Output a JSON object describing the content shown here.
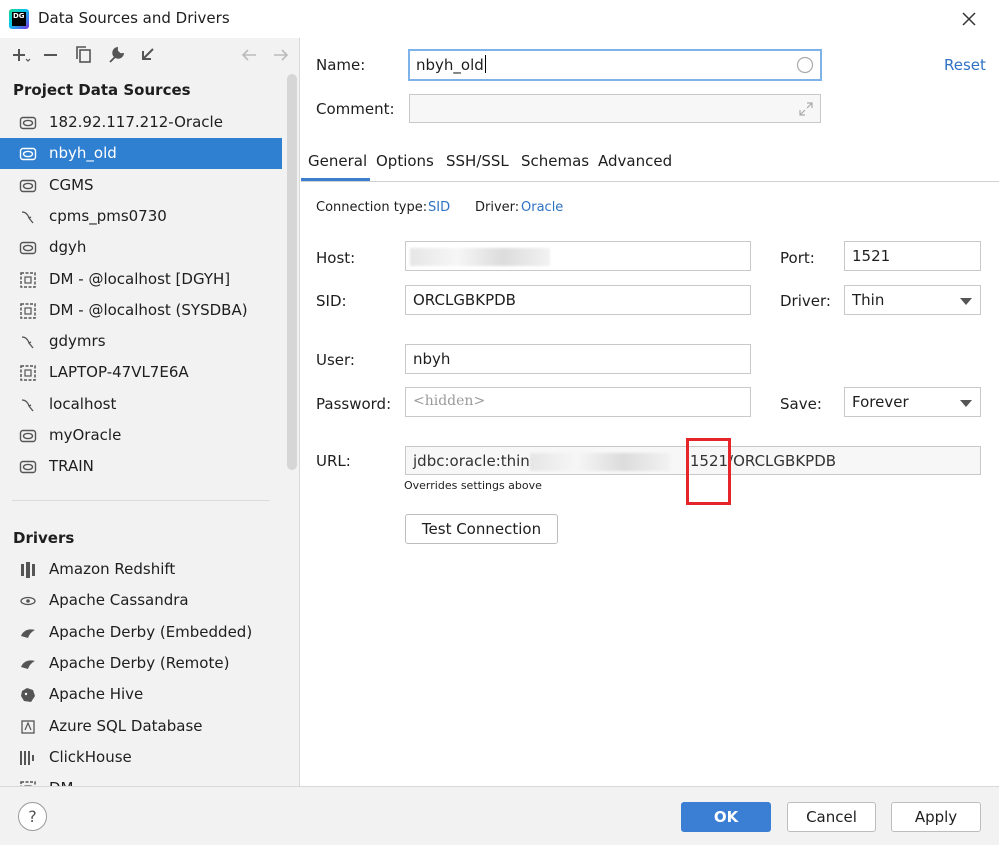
{
  "window": {
    "title": "Data Sources and Drivers"
  },
  "left": {
    "project_header": "Project Data Sources",
    "data_sources": [
      {
        "label": "182.92.117.212-Oracle",
        "icon": "oracle-icon",
        "selected": false
      },
      {
        "label": "nbyh_old",
        "icon": "oracle-icon",
        "selected": true
      },
      {
        "label": "CGMS",
        "icon": "oracle-icon",
        "selected": false
      },
      {
        "label": "cpms_pms0730",
        "icon": "mysql-icon",
        "selected": false
      },
      {
        "label": "dgyh",
        "icon": "oracle-icon",
        "selected": false
      },
      {
        "label": "DM - @localhost [DGYH]",
        "icon": "dm-icon",
        "selected": false
      },
      {
        "label": "DM - @localhost  (SYSDBA)",
        "icon": "dm-icon",
        "selected": false
      },
      {
        "label": "gdymrs",
        "icon": "mysql-icon",
        "selected": false
      },
      {
        "label": "LAPTOP-47VL7E6A",
        "icon": "dm-icon",
        "selected": false
      },
      {
        "label": "localhost",
        "icon": "mysql-icon",
        "selected": false
      },
      {
        "label": "myOracle",
        "icon": "oracle-icon",
        "selected": false
      },
      {
        "label": "TRAIN",
        "icon": "oracle-icon",
        "selected": false
      }
    ],
    "drivers_header": "Drivers",
    "drivers": [
      {
        "label": "Amazon Redshift",
        "icon": "redshift-icon"
      },
      {
        "label": "Apache Cassandra",
        "icon": "cassandra-icon"
      },
      {
        "label": "Apache Derby (Embedded)",
        "icon": "derby-icon"
      },
      {
        "label": "Apache Derby (Remote)",
        "icon": "derby-icon"
      },
      {
        "label": "Apache Hive",
        "icon": "hive-icon"
      },
      {
        "label": "Azure SQL Database",
        "icon": "azure-icon"
      },
      {
        "label": "ClickHouse",
        "icon": "clickhouse-icon"
      },
      {
        "label": "DM",
        "icon": "dm-icon"
      }
    ]
  },
  "form": {
    "name_label": "Name:",
    "name_value": "nbyh_old",
    "comment_label": "Comment:",
    "reset": "Reset",
    "tabs": [
      "General",
      "Options",
      "SSH/SSL",
      "Schemas",
      "Advanced"
    ],
    "connection_type_label": "Connection type:",
    "connection_type_value": "SID",
    "driver_label_top": "Driver:",
    "driver_value_top": "Oracle",
    "host_label": "Host:",
    "host_value": "",
    "port_label": "Port:",
    "port_value": "1521",
    "sid_label": "SID:",
    "sid_value": "ORCLGBKPDB",
    "driver_label": "Driver:",
    "driver_value": "Thin",
    "user_label": "User:",
    "user_value": "nbyh",
    "password_label": "Password:",
    "password_placeholder": "<hidden>",
    "save_label": "Save:",
    "save_value": "Forever",
    "url_label": "URL:",
    "url_prefix": "jdbc:oracle:thin:@",
    "url_suffix": "1521/ORCLGBKPDB",
    "url_note": "Overrides settings above",
    "test_connection": "Test Connection"
  },
  "footer": {
    "help": "?",
    "ok": "OK",
    "cancel": "Cancel",
    "apply": "Apply"
  },
  "colors": {
    "accent": "#2f80d1",
    "link": "#2f72c4",
    "highlight_box": "#e5252a"
  }
}
